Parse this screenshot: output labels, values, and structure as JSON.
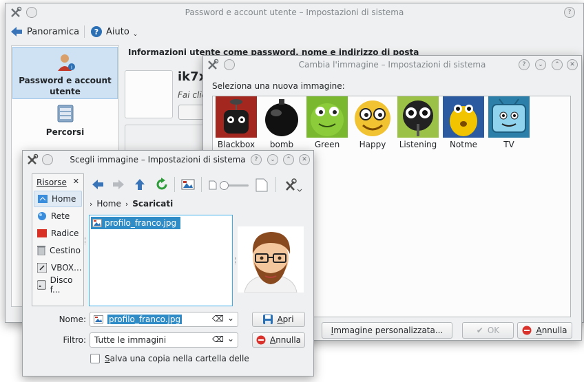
{
  "main_window": {
    "title": "Password e account utente – Impostazioni di sistema",
    "nav_overview": "Panoramica",
    "nav_help": "Aiuto",
    "sidebar": [
      {
        "label": "Password e account utente"
      },
      {
        "label": "Percorsi"
      }
    ],
    "header_text": "Informazioni utente come password, nome e indirizzo di posta",
    "username": "ik7x",
    "hint": "Fai clic"
  },
  "image_window": {
    "title": "Cambia l'immagine – Impostazioni di sistema",
    "prompt": "Seleziona una nuova immagine:",
    "avatars": [
      {
        "label": "Blackbox",
        "icon": "blackbox-robot-icon"
      },
      {
        "label": "bomb",
        "icon": "bomb-icon"
      },
      {
        "label": "Green",
        "icon": "green-face-icon"
      },
      {
        "label": "Happy",
        "icon": "happy-face-icon"
      },
      {
        "label": "Listening",
        "icon": "listening-face-icon"
      },
      {
        "label": "Notme",
        "icon": "notme-face-icon"
      },
      {
        "label": "TV",
        "icon": "tv-face-icon"
      }
    ],
    "custom_image_button": "Immagine personalizzata...",
    "ok_button": "OK",
    "cancel_button": "Annulla"
  },
  "file_dialog": {
    "title": "Scegli immagine – Impostazioni di sistema",
    "places_header": "Risorse",
    "places": [
      {
        "label": "Home",
        "icon": "home-folder-icon"
      },
      {
        "label": "Rete",
        "icon": "network-icon"
      },
      {
        "label": "Radice",
        "icon": "root-folder-icon"
      },
      {
        "label": "Cestino",
        "icon": "trash-icon"
      },
      {
        "label": "VBOX...",
        "icon": "vbox-drive-icon"
      },
      {
        "label": "Disco f...",
        "icon": "disk-icon"
      }
    ],
    "breadcrumb": {
      "home": "Home",
      "current": "Scaricati"
    },
    "files": [
      {
        "name": "profilo_franco.jpg"
      }
    ],
    "name_label": "Nome:",
    "name_value": "profilo_franco.jpg",
    "filter_label": "Filtro:",
    "filter_value": "Tutte le immagini",
    "open_button": "Apri",
    "cancel_button": "Annulla",
    "save_copy_label": "Salva una copia nella cartella delle"
  },
  "colors": {
    "accent": "#3daee9",
    "selection": "#308cc6",
    "window_bg": "#eff0f1"
  }
}
